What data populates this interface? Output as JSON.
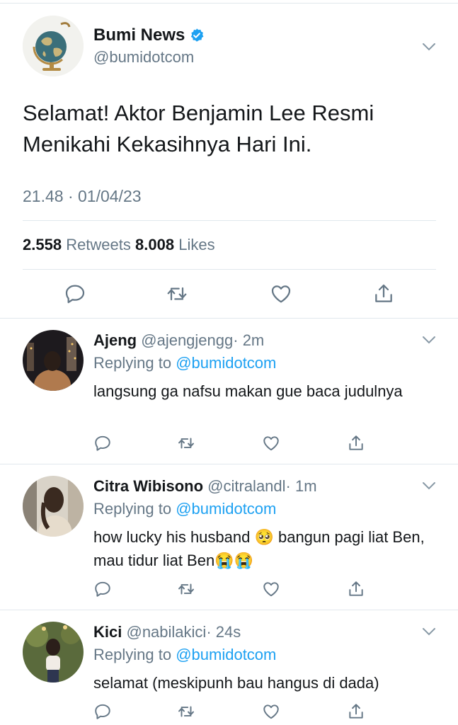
{
  "main_tweet": {
    "name": "Bumi News",
    "handle": "@bumidotcom",
    "text": "Selamat! Aktor Benjamin Lee Resmi Menikahi Kekasihnya Hari Ini.",
    "time": "21.48 · 01/04/23",
    "retweets_count": "2.558",
    "retweets_label": "Retweets",
    "likes_count": "8.008",
    "likes_label": "Likes"
  },
  "replies": [
    {
      "name": "Ajeng",
      "handle": "@ajengjengg",
      "time": "· 2m",
      "replying_prefix": "Replying to",
      "replying_to": "@bumidotcom",
      "text": "langsung ga nafsu makan gue baca judulnya"
    },
    {
      "name": "Citra Wibisono",
      "handle": "@citralandl",
      "time": "· 1m",
      "replying_prefix": "Replying to",
      "replying_to": "@bumidotcom",
      "text": "how lucky his husband 🥺 bangun pagi liat Ben, mau tidur liat Ben😭😭"
    },
    {
      "name": "Kici",
      "handle": "@nabilakici",
      "time": "· 24s",
      "replying_prefix": "Replying to",
      "replying_to": "@bumidotcom",
      "text": "selamat (meskipunh bau hangus di dada)"
    }
  ],
  "colors": {
    "accent": "#1da1f2",
    "muted": "#657786",
    "divider": "#e1e8ed",
    "icon": "#657786"
  },
  "icons": [
    "globe-logo",
    "verified-badge-icon",
    "chevron-down-icon",
    "reply-icon",
    "retweet-icon",
    "like-icon",
    "share-icon"
  ]
}
